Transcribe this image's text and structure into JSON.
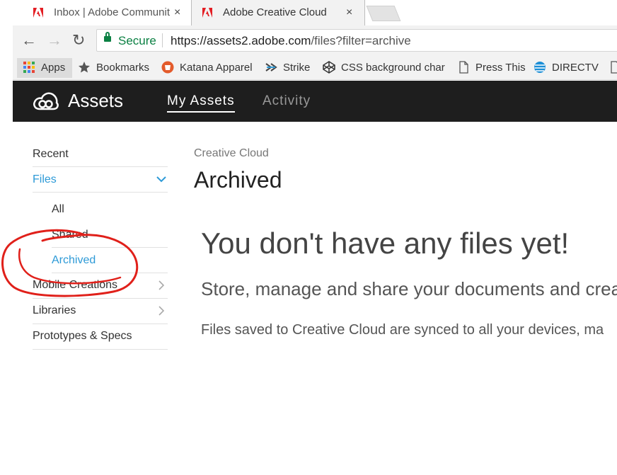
{
  "tabs": [
    {
      "title": "Inbox | Adobe Communit",
      "close": "×",
      "icon": "adobe-icon"
    },
    {
      "title": "Adobe Creative Cloud",
      "close": "×",
      "icon": "adobe-icon"
    }
  ],
  "address": {
    "secure_label": "Secure",
    "url_host": "https://assets2.adobe.com",
    "url_path": "/files?filter=archive"
  },
  "bookmarks": [
    "Apps",
    "Bookmarks",
    "Katana Apparel",
    "Strike",
    "CSS background char",
    "Press This",
    "DIRECTV"
  ],
  "app": {
    "brand": "Assets",
    "nav": [
      "My Assets",
      "Activity"
    ]
  },
  "sidebar": {
    "items": [
      {
        "label": "Recent"
      },
      {
        "label": "Files"
      },
      {
        "label": "All"
      },
      {
        "label": "Shared"
      },
      {
        "label": "Archived"
      },
      {
        "label": "Mobile Creations"
      },
      {
        "label": "Libraries"
      },
      {
        "label": "Prototypes & Specs"
      }
    ]
  },
  "main": {
    "breadcrumb": "Creative Cloud",
    "title": "Archived",
    "empty_heading": "You don't have any files yet!",
    "empty_sub": "Store, manage and share your documents and crea",
    "empty_text": "Files saved to Creative Cloud are synced to all your devices, ma"
  },
  "colors": {
    "accent": "#2d9ad7",
    "annotation": "#e0201a",
    "header_bg": "#1e1e1e"
  }
}
